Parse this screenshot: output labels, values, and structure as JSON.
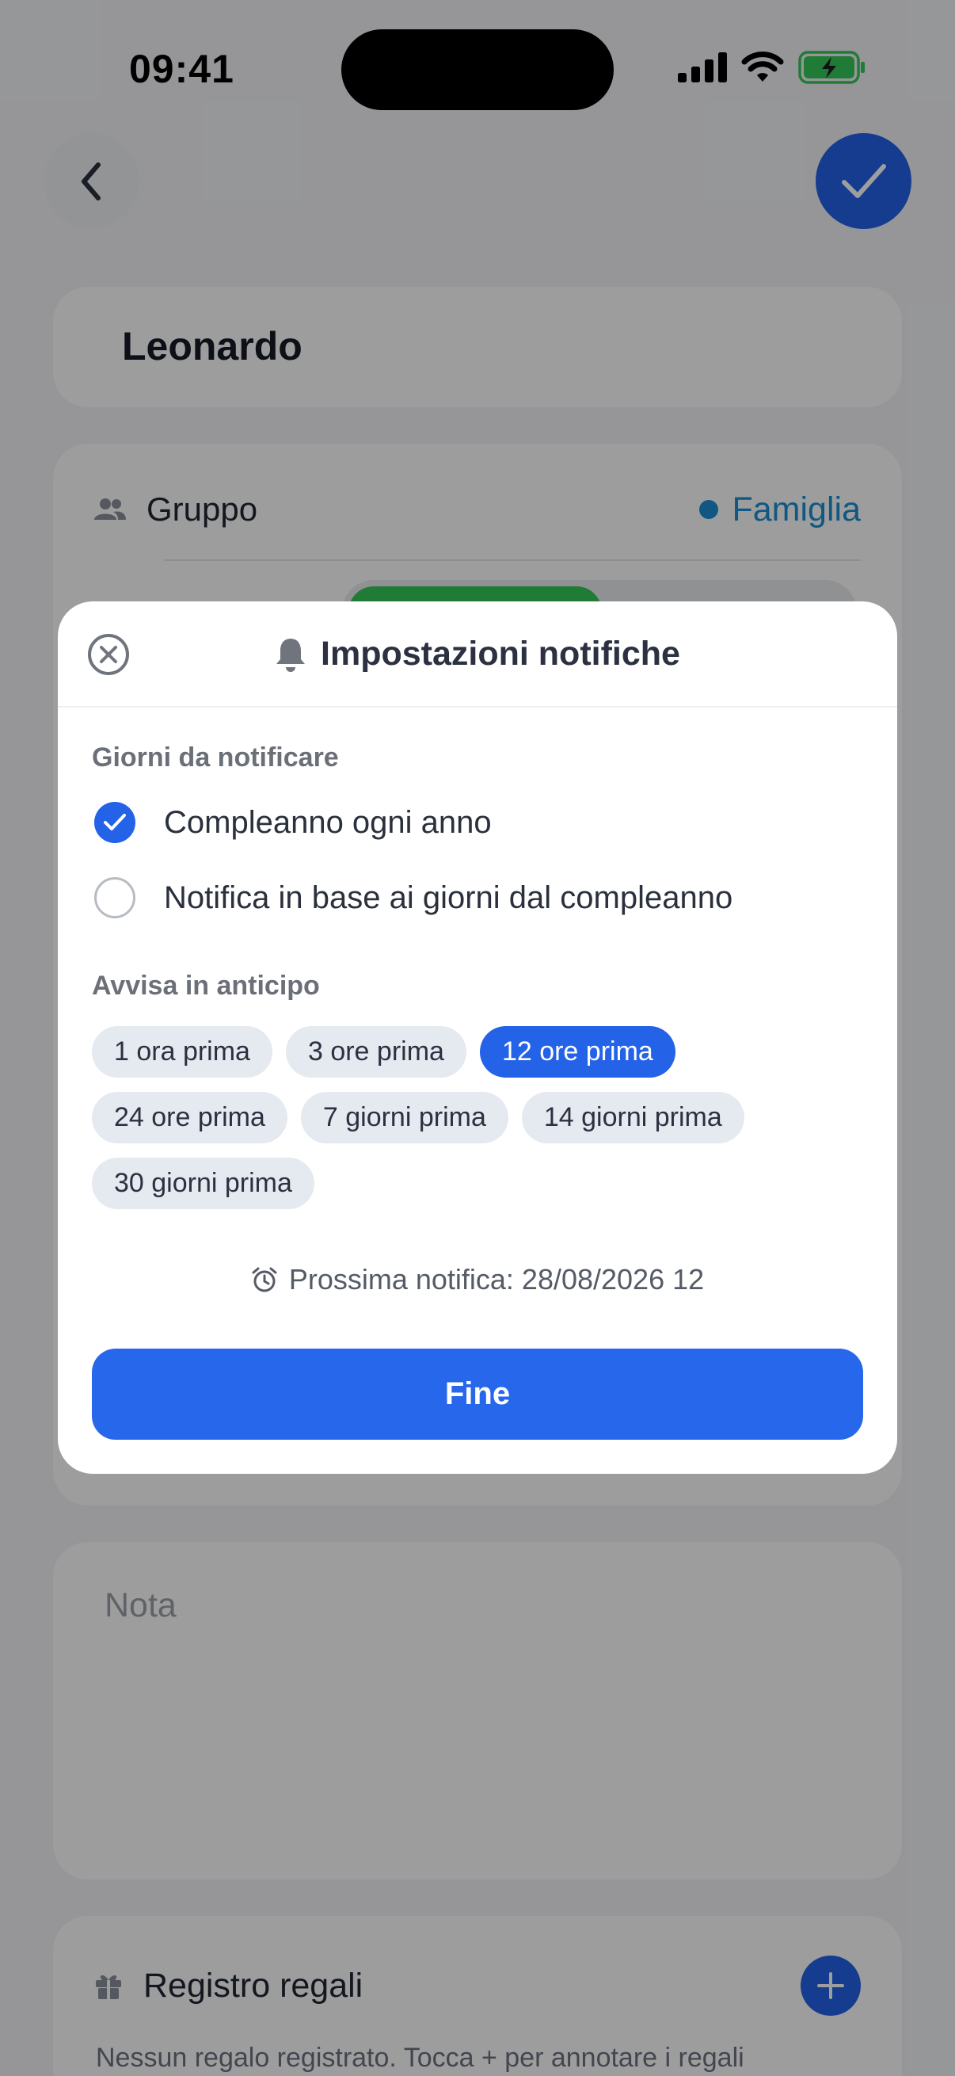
{
  "status_bar": {
    "time": "09:41"
  },
  "contact": {
    "name": "Leonardo"
  },
  "group": {
    "label": "Gruppo",
    "value": "Famiglia"
  },
  "note": {
    "placeholder": "Nota"
  },
  "gifts": {
    "title": "Registro regali",
    "empty_text": "Nessun regalo registrato. Tocca + per annotare i regali"
  },
  "modal": {
    "title": "Impostazioni notifiche",
    "days_section_label": "Giorni da notificare",
    "options": [
      {
        "label": "Compleanno ogni anno",
        "selected": true
      },
      {
        "label": "Notifica in base ai giorni dal compleanno",
        "selected": false
      }
    ],
    "advance_section_label": "Avvisa in anticipo",
    "chips": [
      {
        "label": "1 ora prima",
        "selected": false
      },
      {
        "label": "3 ore prima",
        "selected": false
      },
      {
        "label": "12 ore prima",
        "selected": true
      },
      {
        "label": "24 ore prima",
        "selected": false
      },
      {
        "label": "7 giorni prima",
        "selected": false
      },
      {
        "label": "14 giorni prima",
        "selected": false
      },
      {
        "label": "30 giorni prima",
        "selected": false
      }
    ],
    "next_notification": "Prossima notifica: 28/08/2026 12",
    "done_label": "Fine"
  },
  "colors": {
    "accent": "#2462e7",
    "group": "#1b8fd1",
    "battery": "#34c759"
  }
}
